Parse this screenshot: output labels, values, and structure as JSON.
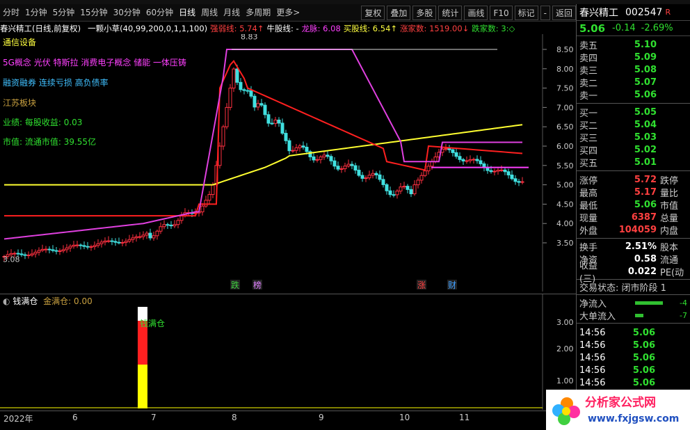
{
  "toolbar": {
    "items": [
      "分时",
      "1分钟",
      "5分钟",
      "15分钟",
      "30分钟",
      "60分钟",
      "日线",
      "周线",
      "月线",
      "多周期",
      "更多>"
    ],
    "active": "日线",
    "right": [
      "叠加",
      "多股",
      "统计",
      "画线",
      "F10",
      "标记",
      "-",
      "返回"
    ],
    "first": "复权"
  },
  "info": {
    "name": "春兴精工(日线,前复权)",
    "indicator": "一颗小草(40,99,200,0,1,1,100)",
    "f1": "强弱线: 5.74↑",
    "f2": "牛股线: -",
    "f3": "龙脉: 6.08",
    "f4": "买股线: 6.54↑",
    "f5": "涨家数: 1519.00↓",
    "f6": "跌家数: 3:◇"
  },
  "tags": [
    "通信设备",
    "5G概念 光伏 特斯拉 消费电子概念 储能 一体压铸",
    "融资融券 连续亏损 高负债率",
    "江苏板块",
    "业绩: 每股收益: 0.03",
    "市值: 流通市值: 39.55亿"
  ],
  "price_axis": [
    "8.50",
    "8.00",
    "7.50",
    "7.00",
    "6.50",
    "6.00",
    "5.50",
    "5.00",
    "4.50",
    "4.00",
    "3.50"
  ],
  "price_marks": {
    "high": "8.83",
    "low": "3.08"
  },
  "panel2": {
    "title": "钱满仓",
    "value": "金满仓: 0.00",
    "label": "钱满仓",
    "axis": [
      "3.00",
      "2.00",
      "1.00"
    ]
  },
  "events": [
    "跌",
    "榜",
    "涨",
    "财"
  ],
  "xaxis": [
    "2022年",
    "6",
    "7",
    "8",
    "9",
    "10",
    "11"
  ],
  "stock": {
    "name": "春兴精工",
    "code": "002547",
    "flag": "R",
    "price": "5.06",
    "change": "-0.14",
    "pct": "-2.69%"
  },
  "asks": [
    {
      "l": "卖五",
      "p": "5.10"
    },
    {
      "l": "卖四",
      "p": "5.09"
    },
    {
      "l": "卖三",
      "p": "5.08"
    },
    {
      "l": "卖二",
      "p": "5.07"
    },
    {
      "l": "卖一",
      "p": "5.06"
    }
  ],
  "bids": [
    {
      "l": "买一",
      "p": "5.05"
    },
    {
      "l": "买二",
      "p": "5.04"
    },
    {
      "l": "买三",
      "p": "5.03"
    },
    {
      "l": "买四",
      "p": "5.02"
    },
    {
      "l": "买五",
      "p": "5.01"
    }
  ],
  "stats": [
    {
      "l": "涨停",
      "v": "5.72",
      "r": "跌停",
      "cl": "red"
    },
    {
      "l": "最高",
      "v": "5.17",
      "r": "量比",
      "cl": "red"
    },
    {
      "l": "最低",
      "v": "5.06",
      "r": "市值",
      "cl": "green"
    },
    {
      "l": "现量",
      "v": "6387",
      "r": "总量",
      "cl": "red"
    },
    {
      "l": "外盘",
      "v": "104059",
      "r": "内盘",
      "cl": "red"
    }
  ],
  "stats2": [
    {
      "l": "换手",
      "v": "2.51%",
      "r": "股本"
    },
    {
      "l": "净资",
      "v": "0.58",
      "r": "流通"
    },
    {
      "l": "收益(三)",
      "v": "0.022",
      "r": "PE(动"
    }
  ],
  "state": "交易状态: 闭市阶段 1",
  "flows": [
    {
      "l": "净流入",
      "v": "-4"
    },
    {
      "l": "大单流入",
      "v": "-7"
    }
  ],
  "ticks": [
    {
      "t": "14:56",
      "p": "5.06"
    },
    {
      "t": "14:56",
      "p": "5.06"
    },
    {
      "t": "14:56",
      "p": "5.06"
    },
    {
      "t": "14:56",
      "p": "5.06"
    },
    {
      "t": "14:56",
      "p": "5.06"
    }
  ],
  "logo": {
    "title": "分析家公式网",
    "url": "www.fxjgsw.com"
  }
}
